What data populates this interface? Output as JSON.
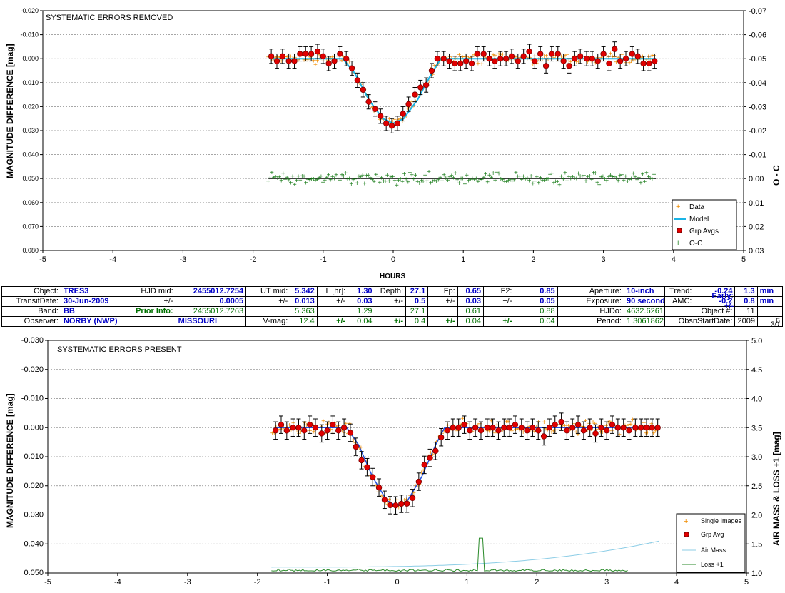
{
  "chart_data": [
    {
      "type": "scatter",
      "title": "SYSTEMATIC ERRORS REMOVED",
      "xlabel": "HOURS",
      "ylabel": "MAGNITUDE DIFFERENCE [mag]",
      "y2label": "O - C",
      "xlim": [
        -5,
        5
      ],
      "ylim": [
        -0.02,
        0.08
      ],
      "y2lim": [
        -0.07,
        0.03
      ],
      "x_ticks": [
        "-5",
        "-4",
        "-3",
        "-2",
        "-1",
        "0",
        "1",
        "2",
        "3",
        "4",
        "5"
      ],
      "y_ticks": [
        "-0.020",
        "-0.010",
        "0.000",
        "0.010",
        "0.020",
        "0.030",
        "0.040",
        "0.050",
        "0.060",
        "0.070",
        "0.080"
      ],
      "y2_ticks": [
        "-0.07",
        "-0.06",
        "-0.05",
        "-0.04",
        "-0.03",
        "-0.02",
        "-0.01",
        "0.00",
        "0.01",
        "0.02",
        "0.03"
      ],
      "legend": [
        "Data",
        "Model",
        "Grp Avgs",
        "O-C"
      ],
      "legend_position": "bottom-right",
      "model": {
        "x": [
          -1.75,
          -0.72,
          -0.55,
          -0.35,
          -0.15,
          0.0,
          0.15,
          0.35,
          0.55,
          0.68,
          3.75
        ],
        "y": [
          0.0,
          0.0,
          0.006,
          0.017,
          0.025,
          0.027,
          0.025,
          0.017,
          0.006,
          0.0,
          0.0
        ]
      },
      "grp_avgs": {
        "x": [
          -1.74,
          -1.66,
          -1.58,
          -1.49,
          -1.41,
          -1.33,
          -1.25,
          -1.17,
          -1.08,
          -1.0,
          -0.92,
          -0.84,
          -0.76,
          -0.67,
          -0.59,
          -0.51,
          -0.43,
          -0.35,
          -0.26,
          -0.18,
          -0.1,
          -0.02,
          0.06,
          0.14,
          0.22,
          0.31,
          0.39,
          0.47,
          0.55,
          0.63,
          0.72,
          0.8,
          0.88,
          0.96,
          1.04,
          1.12,
          1.2,
          1.29,
          1.37,
          1.45,
          1.53,
          1.61,
          1.69,
          1.78,
          1.86,
          1.94,
          2.02,
          2.1,
          2.18,
          2.26,
          2.35,
          2.43,
          2.51,
          2.59,
          2.67,
          2.76,
          2.84,
          2.92,
          3.0,
          3.08,
          3.16,
          3.24,
          3.32,
          3.41,
          3.49,
          3.57,
          3.65,
          3.73
        ],
        "y": [
          -0.001,
          0.001,
          -0.001,
          0.001,
          0.001,
          -0.002,
          -0.002,
          -0.002,
          -0.003,
          -0.001,
          0.002,
          0.001,
          -0.002,
          0.0,
          0.004,
          0.009,
          0.013,
          0.018,
          0.021,
          0.024,
          0.027,
          0.028,
          0.027,
          0.023,
          0.019,
          0.015,
          0.012,
          0.011,
          0.005,
          0.0,
          0.0,
          0.001,
          0.002,
          0.002,
          0.001,
          0.002,
          -0.002,
          -0.002,
          0.0,
          0.001,
          0.0,
          0.0,
          -0.001,
          0.001,
          -0.001,
          -0.003,
          0.001,
          -0.002,
          0.003,
          -0.002,
          -0.002,
          0.001,
          0.003,
          0.0,
          -0.001,
          0.0,
          0.0,
          0.001,
          -0.002,
          0.002,
          -0.004,
          0.001,
          0.0,
          -0.002,
          -0.001,
          0.002,
          0.002,
          0.001
        ],
        "err": 0.003
      },
      "oc_residual_range": [
        -0.007,
        0.007
      ]
    },
    {
      "type": "scatter",
      "title": "SYSTEMATIC ERRORS PRESENT",
      "xlabel": "",
      "ylabel": "MAGNITUDE DIFFERENCE [mag]",
      "y2label": "AIR MASS & LOSS +1 [mag]",
      "xlim": [
        -5,
        5
      ],
      "ylim": [
        -0.03,
        0.05
      ],
      "y2lim": [
        1.0,
        5.0
      ],
      "x_ticks": [
        "-5",
        "-4",
        "-3",
        "-2",
        "-1",
        "0",
        "1",
        "2",
        "3",
        "4",
        "5"
      ],
      "y_ticks": [
        "-0.030",
        "-0.020",
        "-0.010",
        "0.000",
        "0.010",
        "0.020",
        "0.030",
        "0.040",
        "0.050"
      ],
      "y2_ticks": [
        "5.0",
        "4.5",
        "4.0",
        "3.5",
        "3.0",
        "2.5",
        "2.0",
        "1.5",
        "1.0"
      ],
      "legend": [
        "Single Images",
        "Grp Avg",
        "Air Mass",
        "Loss +1"
      ],
      "legend_position": "bottom-right",
      "air_mass": {
        "x": [
          -1.8,
          -1.0,
          0.0,
          1.0,
          2.0,
          3.0,
          3.75
        ],
        "y": [
          1.12,
          1.1,
          1.07,
          1.05,
          1.1,
          1.3,
          1.55
        ]
      },
      "loss": {
        "x": [
          -1.8,
          1.15,
          1.2,
          1.25,
          3.3
        ],
        "y": [
          1.05,
          1.05,
          1.6,
          1.05,
          1.0
        ]
      },
      "grp_avg_offsets": [
        0.001,
        -0.001,
        0.001,
        0.0,
        0.0,
        0.001,
        -0.001,
        0.0,
        0.002,
        0.001,
        -0.001,
        0.001,
        0.0,
        0.0,
        0.002,
        0.003,
        0.001,
        0.0,
        0.0,
        0.001,
        0.001,
        0.0,
        0.0,
        0.001,
        0.002,
        0.0,
        -0.002,
        0.0,
        0.002,
        0.001,
        0.001,
        0.0,
        0.0,
        -0.001,
        0.001,
        0.0,
        0.001,
        0.0,
        0.0,
        0.001,
        0.0,
        0.0,
        -0.001,
        0.0,
        0.001,
        0.0,
        0.001,
        0.003,
        0.0,
        -0.001,
        -0.002,
        0.001,
        0.0,
        -0.001,
        0.001,
        0.0,
        0.002,
        0.0,
        0.001,
        -0.001,
        0.0,
        0.0,
        0.001,
        0.0,
        0.0,
        0.0,
        0.0,
        0.0
      ]
    }
  ],
  "info_table": {
    "row1": {
      "object_label": "Object:",
      "object": "TRES3",
      "hjd_mid_label": "HJD mid:",
      "hjd_mid": "2455012.7254",
      "ut_mid_label": "UT mid:",
      "ut_mid": "5.342",
      "l_label": "L [hr]:",
      "l": "1.30",
      "depth_label": "Depth:",
      "depth": "27.1",
      "fp_label": "Fp:",
      "fp": "0.65",
      "f2_label": "F2:",
      "f2": "0.85",
      "aperture_label": "Aperture:",
      "aperture": "10-inch",
      "trend_label": "Trend:",
      "trend": "-0.24",
      "early_label": "Early:",
      "early": "1.3",
      "min": "min"
    },
    "row2": {
      "transit_label": "TransitDate:",
      "transit_date": "30-Jun-2009",
      "pm": "+/-",
      "hjd_err": "0.0005",
      "ut_pm": "+/-",
      "ut_err": "0.013",
      "l_pm": "+/-",
      "l_err": "0.03",
      "d_pm": "+/-",
      "d_err": "0.5",
      "fp_pm": "+/-",
      "fp_err": "0.03",
      "f2_pm": "+/-",
      "f2_err": "0.05",
      "exposure_label": "Exposure:",
      "exposure": "90 seconds",
      "amc_label": "AMC:",
      "amc": "-0.2",
      "amc_pm": "+/-",
      "early_err": "0.8",
      "min": "min"
    },
    "row3": {
      "band_label": "Band:",
      "band": "BB",
      "prior_label": "Prior Info:",
      "prior_hjd": "2455012.7263",
      "prior_ut": "5.363",
      "prior_l": "1.29",
      "prior_depth": "27.1",
      "prior_fp": "0.61",
      "prior_f2": "0.88",
      "hjdo_label": "HJDo:",
      "hjdo": "4632.6261",
      "object_num_label": "Object #:",
      "object_num": "11"
    },
    "row4": {
      "observer_label": "Observer:",
      "observer": "NORBY (NWP)",
      "location": "MISSOURI",
      "vmag_label": "V-mag:",
      "vmag": "12.4",
      "v_pm": "+/-",
      "v_err": "0.04",
      "l_pm": "+/-",
      "l_err": "0.4",
      "d_pm": "+/-",
      "d_err": "0.04",
      "f_pm": "+/-",
      "f_err": "0.04",
      "period_label": "Period:",
      "period": "1.3061862",
      "obsn_label": "ObsnStartDate:",
      "year": "2009",
      "month": "6",
      "day": "30"
    }
  },
  "colors": {
    "data": "#f08c00",
    "model": "#19b4e6",
    "model2": "#2050e0",
    "grp": "#e00000",
    "oc": "#208020",
    "airmass": "#8ccde6",
    "loss": "#2a8a2a",
    "label_blue": "#0000c8",
    "label_green": "#007000"
  }
}
